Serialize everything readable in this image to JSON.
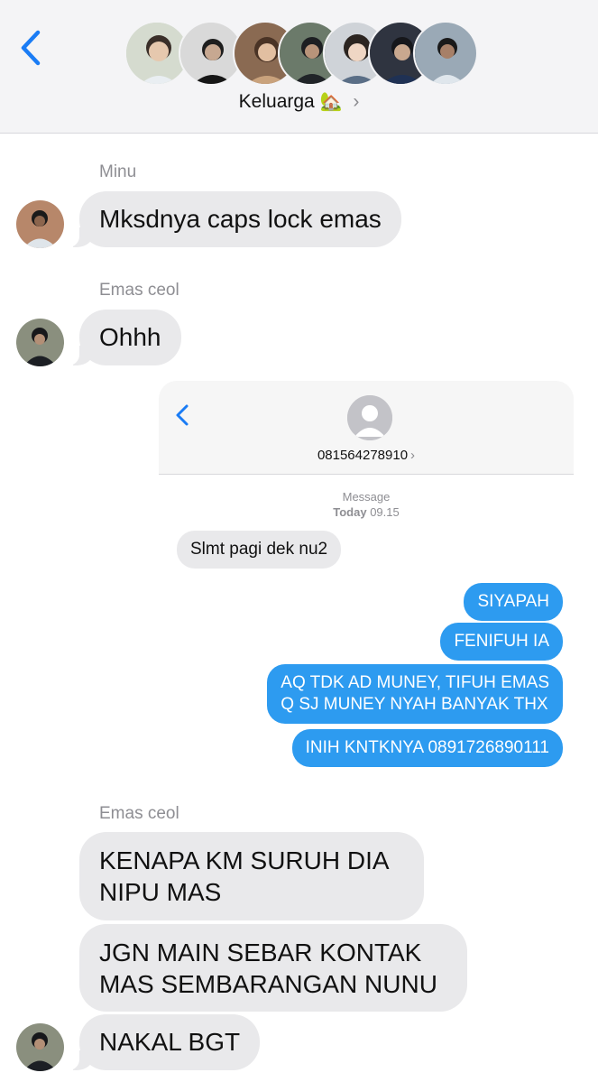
{
  "header": {
    "back_icon": "chevron-left-icon",
    "group_name": "Keluarga",
    "group_emoji": "🏡",
    "chevron": "›",
    "accent_color": "#1a7cf5"
  },
  "thread": [
    {
      "sender": "Minu",
      "text": "Mksdnya caps lock emas"
    },
    {
      "sender": "Emas ceol",
      "text": "Ohhh"
    }
  ],
  "screenshot": {
    "back_icon": "chevron-left-icon",
    "contact_number": "081564278910",
    "chevron": "›",
    "service": "Message",
    "date_day": "Today",
    "date_time": "09.15",
    "incoming": "Slmt pagi dek nu2",
    "outgoing": [
      "SIYAPAH",
      "FENIFUH IA",
      "AQ TDK AD MUNEY, TIFUH EMAS",
      "Q SJ MUNEY NYAH BANYAK THX",
      "INIH KNTKNYA 0891726890111"
    ],
    "blue_color": "#2d9bf0"
  },
  "reply_group": {
    "sender": "Emas ceol",
    "messages": [
      {
        "line1": "KENAPA KM SURUH DIA",
        "line2": "NIPU MAS"
      },
      {
        "line1": "JGN MAIN SEBAR KONTAK",
        "line2": "MAS SEMBARANGAN NUNU"
      },
      {
        "line1": "NAKAL BGT"
      }
    ]
  }
}
